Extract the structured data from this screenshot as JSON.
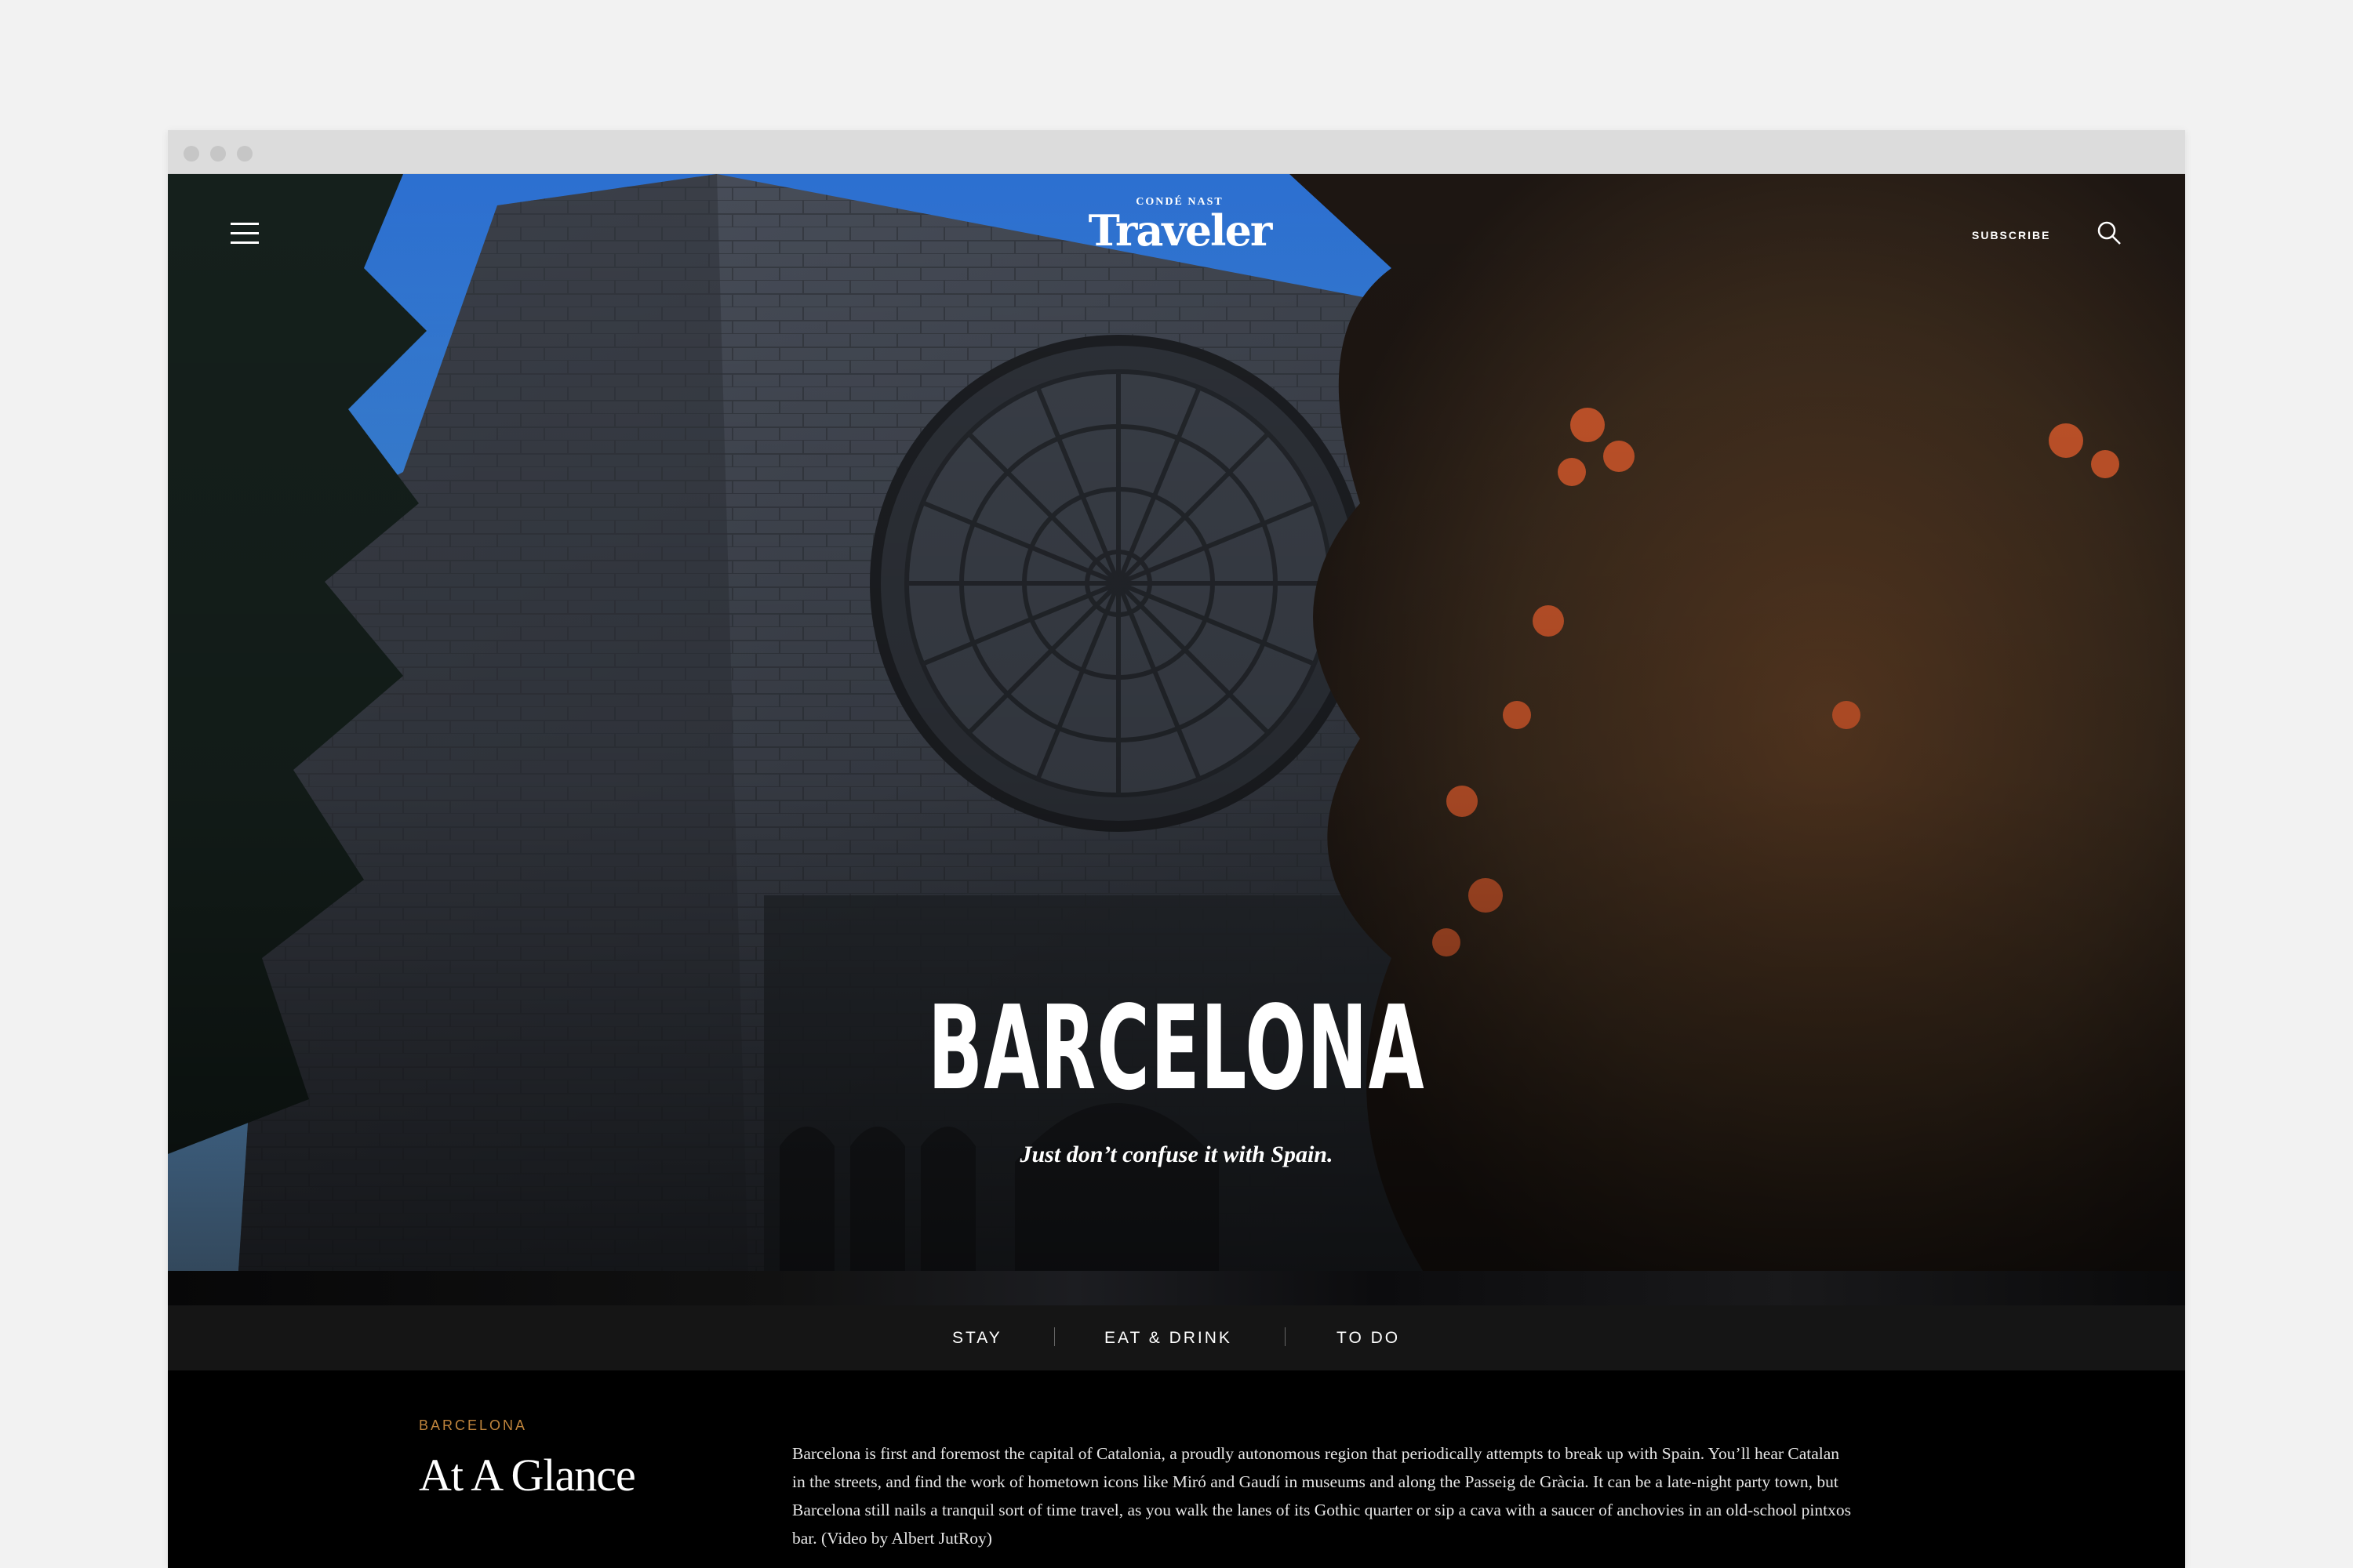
{
  "header": {
    "logo_top": "CONDÉ NAST",
    "logo_main": "Traveler",
    "subscribe_label": "SUBSCRIBE"
  },
  "hero": {
    "title": "BARCELONA",
    "tagline": "Just don’t confuse it with Spain."
  },
  "section_nav": {
    "items": [
      {
        "label": "STAY"
      },
      {
        "label": "EAT & DRINK"
      },
      {
        "label": "TO DO"
      }
    ]
  },
  "content": {
    "kicker": "BARCELONA",
    "title": "At A Glance",
    "body": "Barcelona is first and foremost the capital of Catalonia, a proudly autonomous region that periodically attempts to break up with Spain. You’ll hear Catalan in the streets, and find the work of hometown icons like Miró and Gaudí in museums and along the Passeig de Gràcia. It can be a late-night party town, but Barcelona still nails a tranquil sort of time travel, as you walk the lanes of its Gothic quarter or sip a cava with a saucer of anchovies in an old-school pintxos bar. (Video by Albert JutRoy)"
  },
  "colors": {
    "kicker": "#c0843c",
    "nav_bg": "#151515",
    "sky": "#3f8fe0"
  },
  "icons": [
    "menu-icon",
    "search-icon"
  ]
}
